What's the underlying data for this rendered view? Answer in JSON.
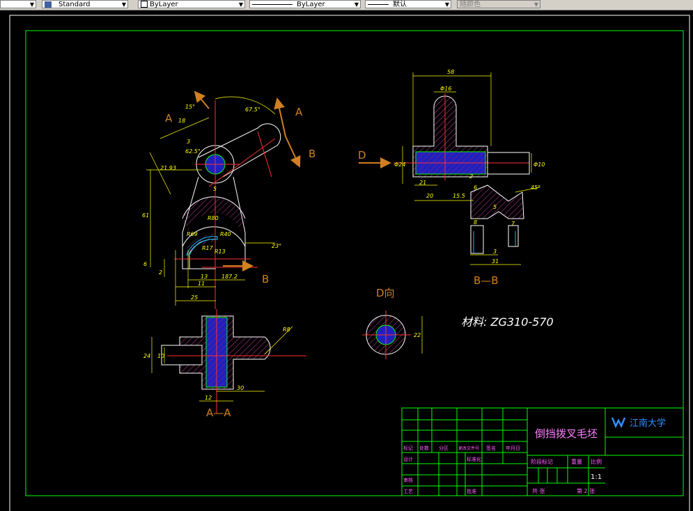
{
  "toolbar": {
    "style_value": "Standard",
    "layer_value": "ByLayer",
    "linetype_value": "ByLayer",
    "lineweight_value": "默认",
    "color_value": "随颜色"
  },
  "drawing": {
    "view_labels": {
      "section_a": "A",
      "section_a2": "A",
      "section_b": "B",
      "section_b2": "B",
      "view_d": "D",
      "aa_title": "A—A",
      "bb_title": "B—B",
      "d_view_title": "D向"
    },
    "material": "材料: ZG310-570",
    "dimensions": {
      "d15": "15°",
      "d675": "67.5°",
      "d18": "18",
      "d3": "3",
      "d625": "62.5°",
      "d2193": "21.93",
      "d5": "5",
      "d61": "61",
      "r80": "R80",
      "r40": "R40",
      "r69": "R69",
      "r17": "R17",
      "r13": "R13",
      "d23": "23°",
      "d6": "6",
      "d2": "2",
      "d13": "13",
      "d11": "11",
      "d1872": "187.2",
      "d25": "25",
      "b58": "58",
      "b16": "Φ16",
      "b24": "Φ24",
      "b10": "Φ10",
      "b21": "21",
      "b20": "20",
      "b155": "15.5",
      "b6": "6",
      "b45": "45°",
      "b5": "5",
      "b8": "8",
      "b7": "7",
      "b3": "3",
      "b31": "31",
      "b2": "2",
      "a24": "24",
      "a10": "10",
      "r8": "R8",
      "a12": "12",
      "a30": "30",
      "d22": "22"
    }
  },
  "title_block": {
    "part_name": "倒挡拨叉毛坯",
    "university": "江南大学",
    "row_labels": [
      "标记",
      "处数",
      "分区",
      "更改文件号",
      "签名",
      "年月日"
    ],
    "design": "设计",
    "standardize": "标准化",
    "review": "审核",
    "process": "工艺",
    "approve": "批准",
    "stage_labels": [
      "阶段标记",
      "重量",
      "比例"
    ],
    "scale": "1:1",
    "sheets": "共 张",
    "sheet_no": "第 2 张"
  }
}
